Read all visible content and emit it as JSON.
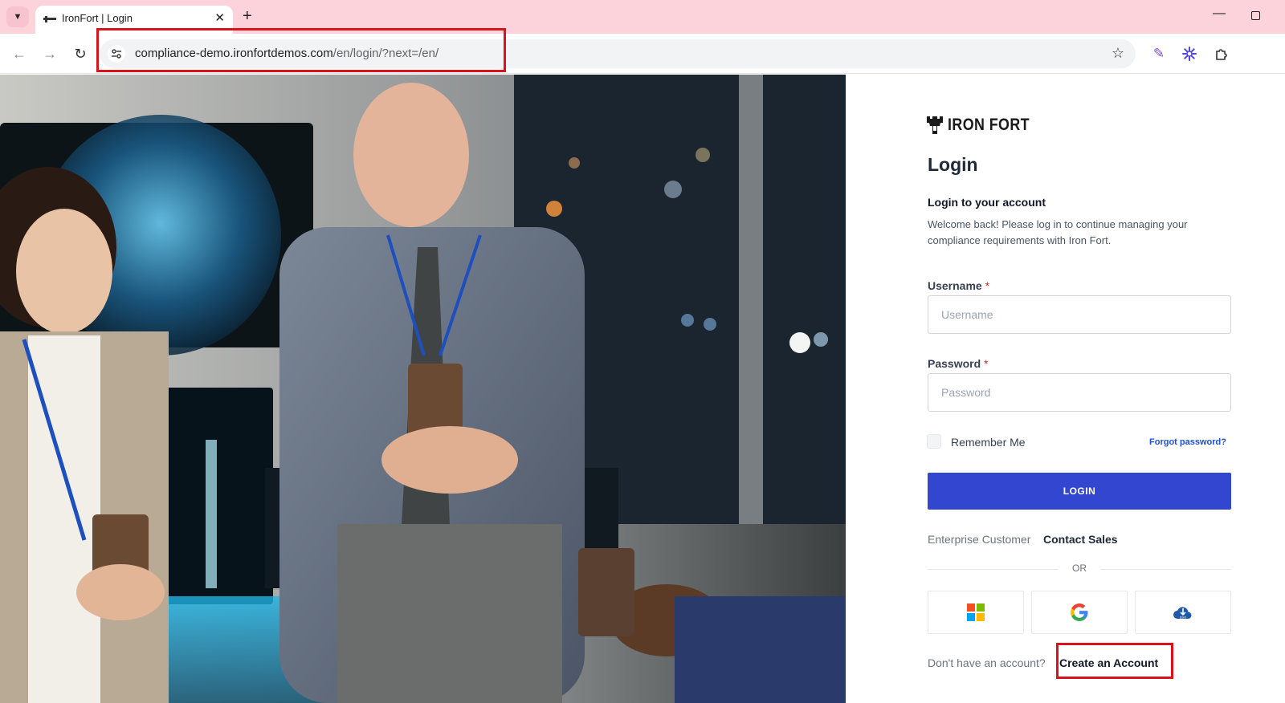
{
  "browser": {
    "tab_title": "IronFort | Login",
    "url_host": "compliance-demo.ironfortdemos.com",
    "url_path": "/en/login/?next=/en/",
    "icons": [
      "chevron-down-icon",
      "close-icon",
      "plus-icon",
      "minimize-icon",
      "maximize-icon",
      "back-arrow-icon",
      "forward-arrow-icon",
      "reload-icon",
      "site-settings-icon",
      "star-icon",
      "pen-extension-icon",
      "ai-extension-icon",
      "puzzle-icon"
    ]
  },
  "brand": {
    "name": "IRON FORT"
  },
  "login": {
    "title": "Login",
    "subtitle": "Login to your account",
    "welcome": "Welcome back! Please log in to continue managing your compliance requirements with Iron Fort.",
    "username_label": "Username",
    "username_placeholder": "Username",
    "password_label": "Password",
    "password_placeholder": "Password",
    "required_mark": "*",
    "remember_me": "Remember Me",
    "forgot_password": "Forgot password?",
    "login_button": "LOGIN",
    "enterprise_text": "Enterprise Customer",
    "contact_sales": "Contact Sales",
    "or_text": "OR",
    "no_account_text": "Don't have an account?",
    "create_account": "Create an Account"
  },
  "social": {
    "providers": [
      "Microsoft",
      "Google",
      "SSO"
    ],
    "sso_badge": "SSO"
  },
  "colors": {
    "accent": "#3346cf",
    "link": "#1d4ed8",
    "highlight": "#d9121b",
    "tabstrip": "#fcd2db"
  }
}
